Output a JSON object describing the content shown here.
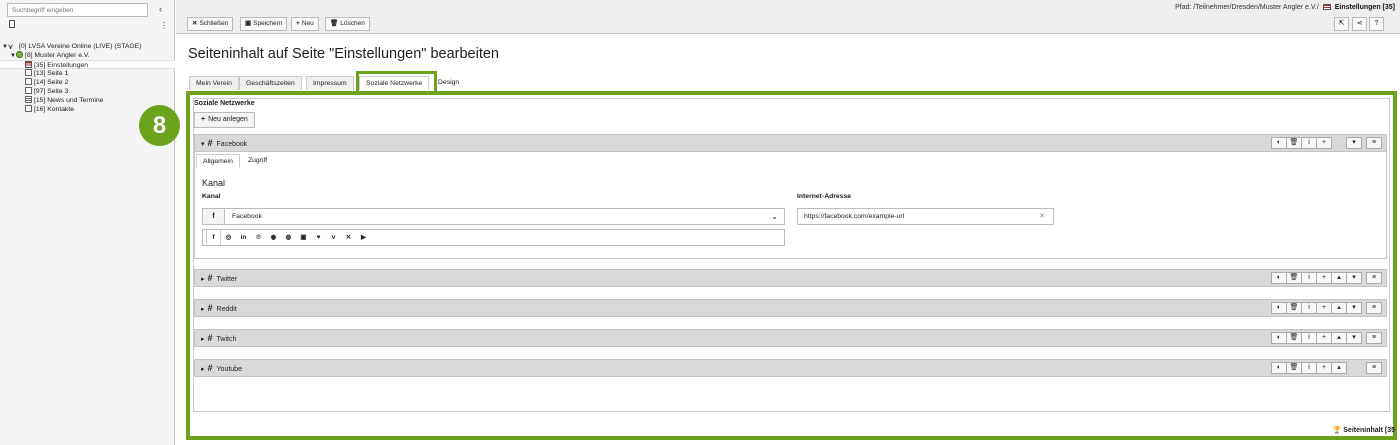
{
  "left_panel": {
    "search_placeholder": "Suchbegriff eingeben",
    "collapse_glyph": "‹",
    "more_glyph": "⋮",
    "tree": [
      {
        "label": "[0] LVSA Vereine Online (LIVE) (STAGE)",
        "icon": "typo3-icon"
      },
      {
        "label": "[8] Muster Angler e.V.",
        "icon": "globe-icon"
      },
      {
        "label": "[35] Einstellungen",
        "icon": "flag-icon"
      },
      {
        "label": "[13] Seite 1",
        "icon": "page-icon"
      },
      {
        "label": "[14] Seite 2",
        "icon": "page-icon"
      },
      {
        "label": "[97] Seite 3",
        "icon": "page-icon"
      },
      {
        "label": "[15] News und Termine",
        "icon": "list-icon"
      },
      {
        "label": "[16] Kontakte",
        "icon": "page-icon"
      }
    ]
  },
  "docheader": {
    "path_prefix": "Pfad: /Teilnehmer/Dresden/Muster Angler e.V./",
    "path_current": "Einstellungen [35]",
    "close_label": "Schließen",
    "save_label": "Speichern",
    "new_label": "Neu",
    "delete_label": "Löschen",
    "help_glyph": "?"
  },
  "main": {
    "title": "Seiteninhalt auf Seite \"Einstellungen\" bearbeiten",
    "tabs": [
      "Mein Verein",
      "Geschäftszeiten",
      "Impressum",
      "Soziale Netzwerke",
      "Design"
    ],
    "badge": "8",
    "section_title": "Soziale Netzwerke",
    "new_record_label": "Neu anlegen",
    "records": [
      "Facebook",
      "Twitter",
      "Reddit",
      "Twitch",
      "Youtube"
    ],
    "subtabs": [
      "Allgemein",
      "Zugriff"
    ],
    "group_title": "Kanal",
    "kanal_label": "Kanal",
    "kanal_value": "Facebook",
    "kanal_addon": "f",
    "url_label": "Internet-Adresse",
    "url_value": "https://facebook.com/example-url",
    "social_icons": [
      "f",
      "◎",
      "in",
      "℗",
      "◉",
      "◍",
      "▣",
      "♥",
      "v",
      "✕",
      "▶"
    ],
    "footer_label": "Seiteninhalt [35"
  },
  "colors": {
    "accent_green": "#6da21d",
    "header_grey": "#d9d9d9"
  }
}
